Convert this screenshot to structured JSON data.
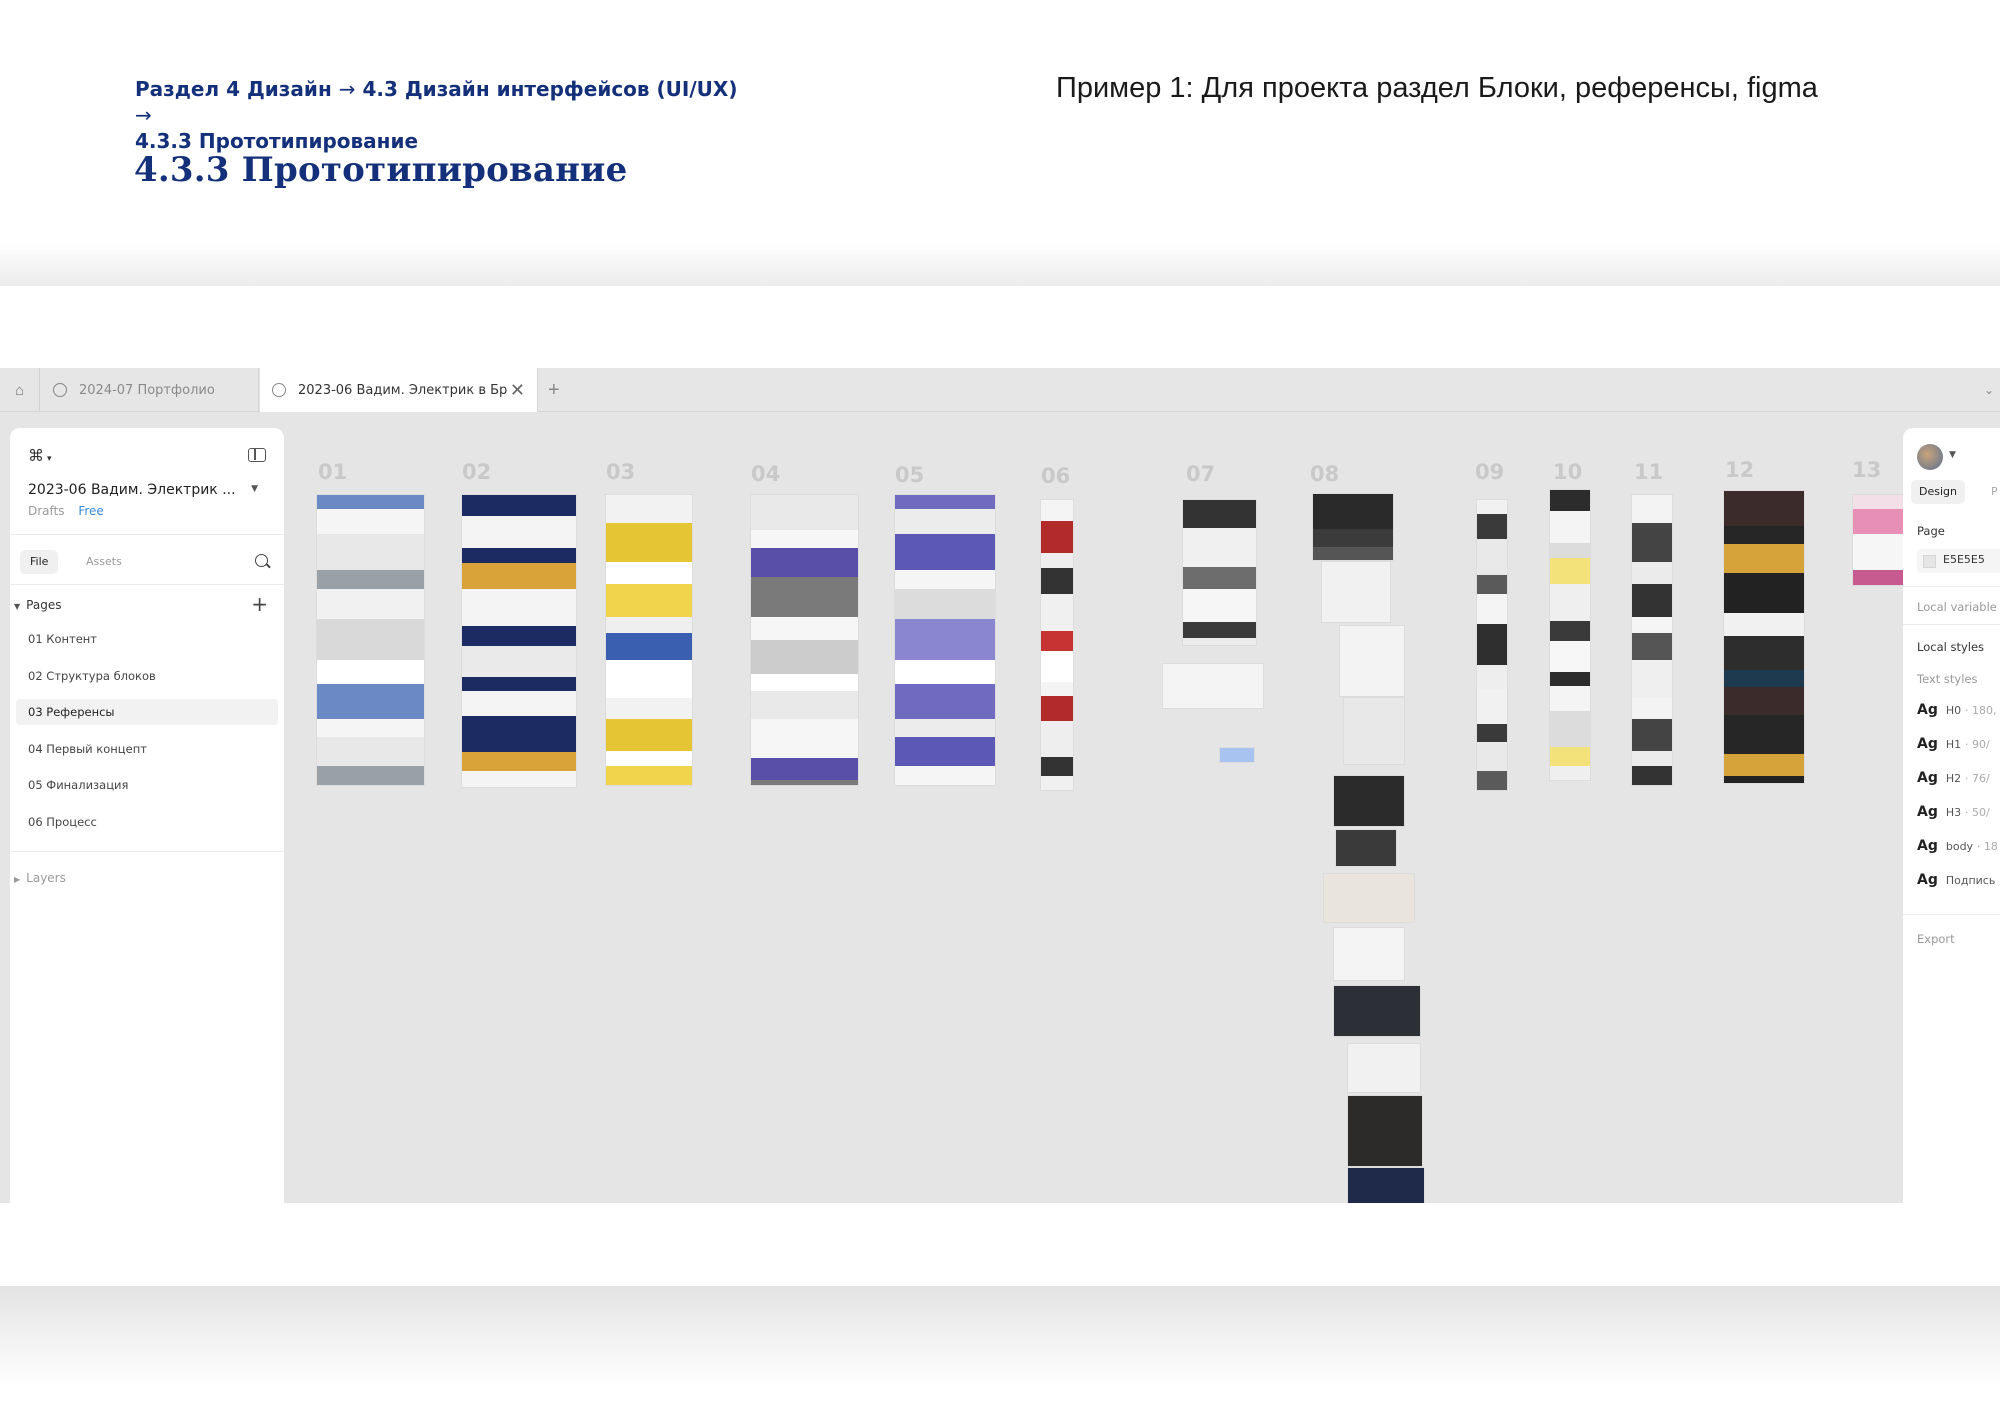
{
  "slide": {
    "breadcrumb_line1": "Раздел 4 Дизайн",
    "breadcrumb_arrow1": "→",
    "breadcrumb_part2": "4.3 Дизайн интерфейсов (UI/UX)",
    "breadcrumb_arrow2": "→",
    "breadcrumb_line2": "4.3.3 Прототипирование",
    "title": "4.3.3 Прототипирование",
    "example_caption": "Пример 1: Для проекта раздел Блоки, референсы, figma"
  },
  "tabs": [
    {
      "label": "2024-07 Портфолио"
    },
    {
      "label": "2023-06 Вадим. Электрик в Бр"
    }
  ],
  "tab_close": "✕",
  "tab_add": "+",
  "left_panel": {
    "file_name": "2023-06 Вадим. Электрик ...",
    "drafts": "Drafts",
    "plan": "Free",
    "file_tab": "File",
    "assets_tab": "Assets",
    "pages_header": "Pages",
    "pages": [
      {
        "label": "01 Контент"
      },
      {
        "label": "02 Структура блоков"
      },
      {
        "label": "03 Референсы",
        "active": true
      },
      {
        "label": "04 Первый концепт"
      },
      {
        "label": "05 Финализация"
      },
      {
        "label": "06 Процесс"
      }
    ],
    "layers_header": "Layers"
  },
  "right_panel": {
    "design_tab": "Design",
    "prototype_tab": "P",
    "page_label": "Page",
    "page_color": "E5E5E5",
    "local_variables": "Local variable",
    "local_styles": "Local styles",
    "text_styles": "Text styles",
    "styles": [
      {
        "ag": "Ag",
        "name": "H0",
        "meta": "· 180,"
      },
      {
        "ag": "Ag",
        "name": "H1",
        "meta": "· 90/"
      },
      {
        "ag": "Ag",
        "name": "H2",
        "meta": "· 76/"
      },
      {
        "ag": "Ag",
        "name": "H3",
        "meta": "· 50/"
      },
      {
        "ag": "Ag",
        "name": "body",
        "meta": "· 18"
      },
      {
        "ag": "Ag",
        "name": "Подпись",
        "meta": ""
      }
    ],
    "export_label": "Export"
  },
  "canvas": {
    "frame_numbers": [
      "01",
      "02",
      "03",
      "04",
      "05",
      "06",
      "07",
      "08",
      "09",
      "10",
      "11",
      "12",
      "13"
    ]
  },
  "colors": {
    "brand_blue": "#15307a",
    "canvas_bg": "#e5e5e5",
    "link_blue": "#3b8ad9"
  }
}
